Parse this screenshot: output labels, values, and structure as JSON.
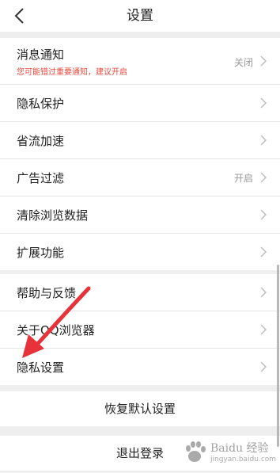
{
  "header": {
    "title": "设置",
    "back_icon": "chevron-left-icon"
  },
  "groups": {
    "main": [
      {
        "label": "消息通知",
        "sub": "您可能错过重要通知，建议开启",
        "value": "关闭"
      },
      {
        "label": "隐私保护",
        "value": ""
      },
      {
        "label": "省流加速",
        "value": ""
      },
      {
        "label": "广告过滤",
        "value": "开启"
      },
      {
        "label": "清除浏览数据",
        "value": ""
      },
      {
        "label": "扩展功能",
        "value": ""
      }
    ],
    "about": [
      {
        "label": "帮助与反馈"
      },
      {
        "label": "关于QQ浏览器"
      },
      {
        "label": "隐私设置"
      }
    ]
  },
  "actions": {
    "restore_label": "恢复默认设置",
    "logout_label": "退出登录"
  },
  "watermark": {
    "brand": "Baidu 经验",
    "url": "jingyan.baidu.com"
  },
  "colors": {
    "background": "#eeeeee",
    "warning": "#e8483a",
    "annotation_arrow": "#e8323a"
  }
}
